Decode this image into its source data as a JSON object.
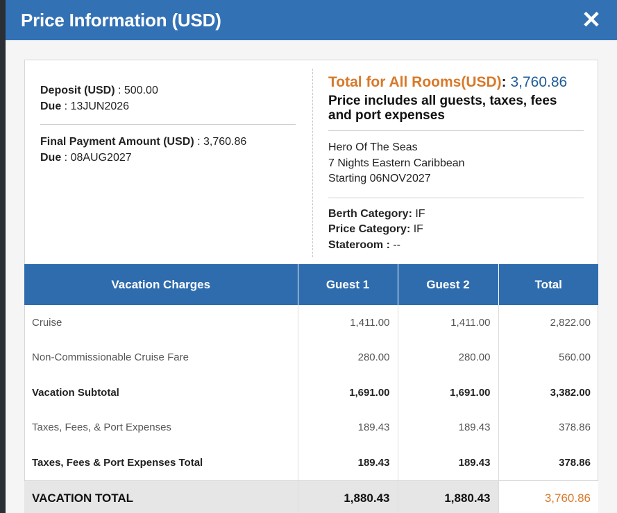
{
  "modal": {
    "title": "Price Information (USD)",
    "close_glyph": "✕"
  },
  "payment": {
    "deposit_label": "Deposit (USD)",
    "deposit_value": " : 500.00",
    "deposit_due_label": "Due",
    "deposit_due_value": " : 13JUN2026",
    "final_label": "Final Payment Amount (USD)",
    "final_value": " : 3,760.86",
    "final_due_label": "Due",
    "final_due_value": " : 08AUG2027"
  },
  "summary": {
    "total_label": "Total for All Rooms(USD)",
    "total_colon": ": ",
    "total_value": "3,760.86",
    "includes_text": "Price includes all guests, taxes, fees and port expenses",
    "ship": "Hero Of The Seas",
    "itinerary": "7 Nights Eastern Caribbean",
    "starting": "Starting 06NOV2027",
    "berth_label": "Berth Category:",
    "berth_value": " IF",
    "price_cat_label": "Price Category:",
    "price_cat_value": " IF",
    "stateroom_label": "Stateroom :",
    "stateroom_value": " --"
  },
  "table": {
    "headers": [
      "Vacation Charges",
      "Guest 1",
      "Guest 2",
      "Total"
    ],
    "rows": [
      {
        "label": "Cruise",
        "g1": "1,411.00",
        "g2": "1,411.00",
        "total": "2,822.00"
      },
      {
        "label": "Non-Commissionable Cruise Fare",
        "g1": "280.00",
        "g2": "280.00",
        "total": "560.00"
      },
      {
        "label": "Vacation Subtotal",
        "g1": "1,691.00",
        "g2": "1,691.00",
        "total": "3,382.00"
      },
      {
        "label": "Taxes, Fees, & Port Expenses",
        "g1": "189.43",
        "g2": "189.43",
        "total": "378.86"
      },
      {
        "label": "Taxes, Fees & Port Expenses Total",
        "g1": "189.43",
        "g2": "189.43",
        "total": "378.86"
      },
      {
        "label": "VACATION TOTAL",
        "g1": "1,880.43",
        "g2": "1,880.43",
        "total": "3,760.86"
      }
    ]
  },
  "colors": {
    "header_blue": "#3371b5",
    "accent_orange": "#d7792a",
    "value_blue": "#1e5b99"
  }
}
